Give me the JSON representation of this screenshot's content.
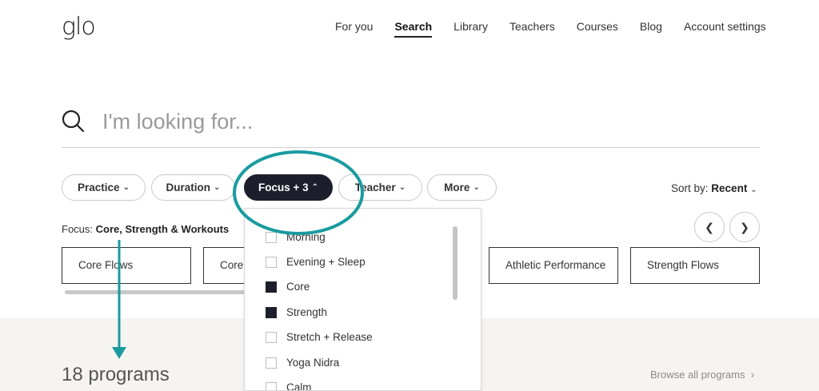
{
  "header": {
    "logo": "glo",
    "nav": [
      "For you",
      "Search",
      "Library",
      "Teachers",
      "Courses",
      "Blog",
      "Account settings"
    ],
    "active_nav": "Search"
  },
  "search": {
    "placeholder": "I'm looking for..."
  },
  "filters": {
    "practice": "Practice",
    "duration": "Duration",
    "focus": "Focus + 3",
    "teacher": "Teacher",
    "more": "More"
  },
  "sort": {
    "label": "Sort by:",
    "value": "Recent"
  },
  "focus_summary": {
    "label": "Focus:",
    "value": "Core, Strength & Workouts"
  },
  "cards": [
    "Core Flows",
    "Core",
    "Athletic Performance",
    "Strength Flows"
  ],
  "dropdown": {
    "items": [
      {
        "label": "Morning",
        "checked": false
      },
      {
        "label": "Evening + Sleep",
        "checked": false
      },
      {
        "label": "Core",
        "checked": true
      },
      {
        "label": "Strength",
        "checked": true
      },
      {
        "label": "Stretch + Release",
        "checked": false
      },
      {
        "label": "Yoga Nidra",
        "checked": false
      },
      {
        "label": "Calm",
        "checked": false
      }
    ]
  },
  "results": {
    "count": "18 programs",
    "browse": "Browse all programs"
  },
  "icons": {
    "search": "search-icon",
    "prev": "chevron-left-icon",
    "next": "chevron-right-icon"
  },
  "colors": {
    "accent_annotation": "#1a9ba0",
    "dark_pill": "#1c1f2b",
    "bottom_bg": "#f6f4f1"
  }
}
